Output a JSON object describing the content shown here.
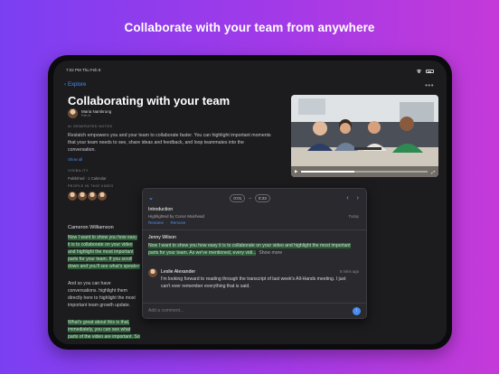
{
  "headline": "Collaborate with your team from anywhere",
  "status_bar": {
    "time": "7:02 PM Thu Feb 8",
    "wifi_icon": "wifi-icon",
    "battery_level": 0.7
  },
  "nav": {
    "back_label": "Explore",
    "more_label": "•••"
  },
  "page": {
    "title": "Collaborating with your team",
    "author_name": "Maria Narskrung",
    "author_sub": "Feb 8",
    "notes_label": "AI GENERATED NOTES",
    "notes": "Reslatch empowers you and your team to collaborate faster. You can highlight important moments that your team needs to see, share ideas and feedback, and loop teammates into the conversation.",
    "show_all": "Show all",
    "visibility_label": "VISIBILITY",
    "visibility_value": "Published · 1 Calendar",
    "people_label": "PEOPLE IN THIS VIDEO"
  },
  "transcript": {
    "speaker": "Cameron Williamson",
    "para1": "Now I want to show you how easy it is to collaborate on your video and highlight the most important parts for your team. If you scroll down and you'll see what's speaker and also notice we have colors",
    "para2": "And so you can have conversations. highlight them directly here to highlight the most important team growth update.",
    "para3": "What's great about this is that, immediately, you can see what parts of the video are important. So it takes you time. You don't have to watch the entire video."
  },
  "video": {
    "play_icon": "play-icon",
    "progress": 0.42
  },
  "popover": {
    "start_time": "0:01",
    "end_time": "0:23",
    "section": "Introduction",
    "highlighted_by": "Highlighted by Conor Muirhead",
    "rename_label": "Rename",
    "remove_label": "Remove",
    "date": "Today",
    "quote_speaker": "Jenny Wilson",
    "quote": "Now I want to show you how easy it is to collaborate on your video and highlight the most important parts for your team. As we've mentioned, every vidi...",
    "show_more": "Show more",
    "comment_author": "Leslie Alexander",
    "comment_time": "5 mins ago",
    "comment_text": "I'm looking forward to reading through the transcript of last week's All-Hands meeting. I just can't ever remember everything that is said.",
    "add_comment_placeholder": "Add a comment..."
  }
}
